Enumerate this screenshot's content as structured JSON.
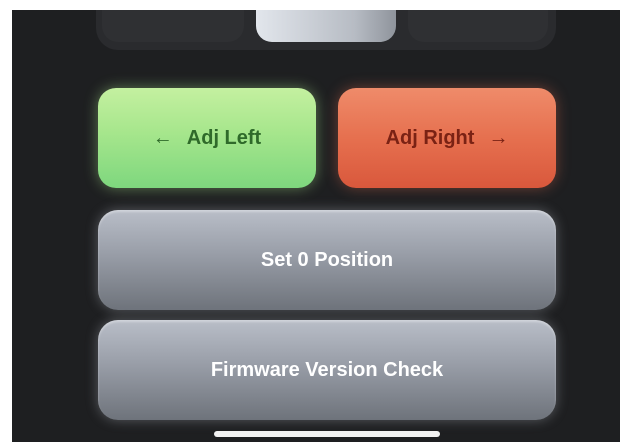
{
  "segmented_control": {
    "options": [
      "...",
      "...",
      "..."
    ],
    "selected_index": 1
  },
  "adjust": {
    "left_label": "Adj Left",
    "left_icon": "arrow-left-icon",
    "right_label": "Adj Right",
    "right_icon": "arrow-right-icon",
    "left_color": "#a6e68c",
    "right_color": "#e6704f"
  },
  "actions": {
    "set_zero_label": "Set 0 Position",
    "firmware_check_label": "Firmware Version Check"
  },
  "glyphs": {
    "arrow_left": "←",
    "arrow_right": "→"
  }
}
